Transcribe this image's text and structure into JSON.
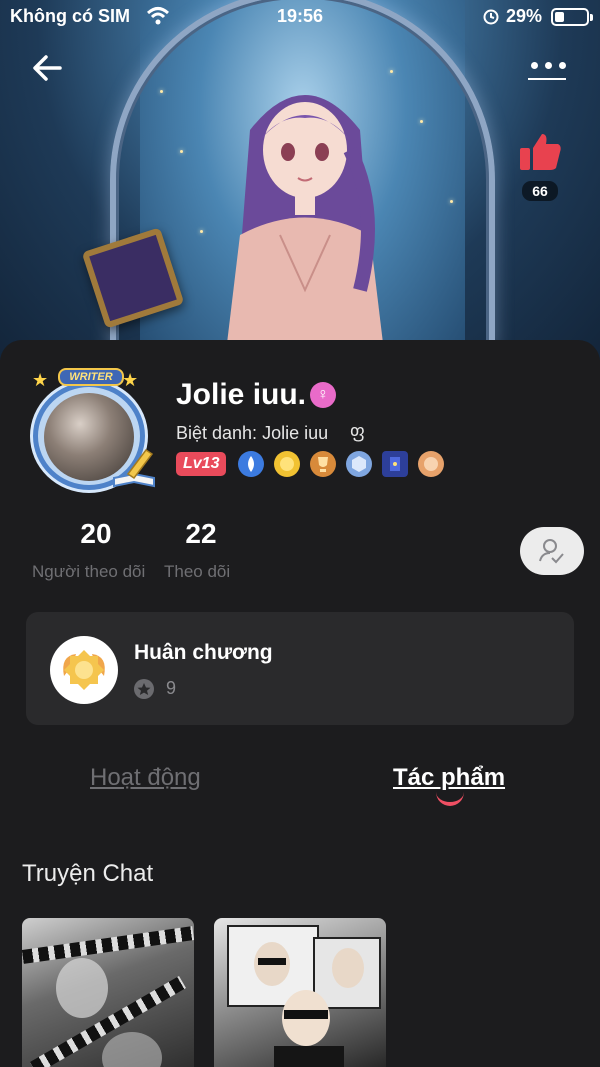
{
  "status_bar": {
    "carrier": "Không có SIM",
    "time": "19:56",
    "battery": "29%"
  },
  "header": {
    "like_count": "66"
  },
  "profile": {
    "badge_label": "WRITER",
    "name": "Jolie iuu.",
    "nickname": "Biệt danh: Jolie iuu",
    "level": "Lv13",
    "badges": [
      "drop-badge",
      "sun-badge",
      "trophy-badge",
      "hexagon-badge",
      "book-badge",
      "peach-badge"
    ]
  },
  "stats": {
    "followers_count": "20",
    "followers_label": "Người theo dõi",
    "following_count": "22",
    "following_label": "Theo dõi"
  },
  "medals": {
    "title": "Huân chương",
    "count": "9"
  },
  "tabs": {
    "activity": "Hoạt động",
    "works": "Tác phẩm",
    "active": "works"
  },
  "section": {
    "title": "Truyện Chat"
  },
  "colors": {
    "accent": "#ef4f63",
    "panel": "#1c1c1e",
    "card": "#2a2a2c",
    "level_badge": "#e94b5b",
    "gender_badge": "#e96bc9"
  }
}
